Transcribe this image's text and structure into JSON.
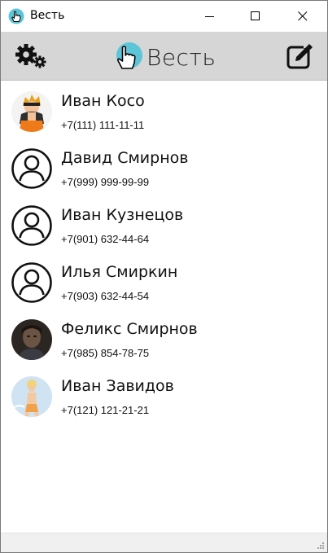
{
  "window": {
    "title": "Весть",
    "icon": "hand-pointer-icon"
  },
  "toolbar": {
    "settings_icon": "gears-icon",
    "brand_name": "Весть",
    "compose_icon": "compose-icon",
    "accent": "#5cc6d8"
  },
  "contacts": [
    {
      "name": "Иван Косо",
      "phone": "+7(111) 111-11-11",
      "avatar": "photo-ninja"
    },
    {
      "name": "Давид Смирнов",
      "phone": "+7(999) 999-99-99",
      "avatar": "default-user-icon"
    },
    {
      "name": "Иван Кузнецов",
      "phone": "+7(901) 632-44-64",
      "avatar": "default-user-icon"
    },
    {
      "name": "Илья Смиркин",
      "phone": "+7(903) 632-44-54",
      "avatar": "default-user-icon"
    },
    {
      "name": "Феликс Смирнов",
      "phone": "+7(985) 854-78-75",
      "avatar": "photo-person"
    },
    {
      "name": "Иван Завидов",
      "phone": "+7(121) 121-21-21",
      "avatar": "photo-figure"
    }
  ]
}
